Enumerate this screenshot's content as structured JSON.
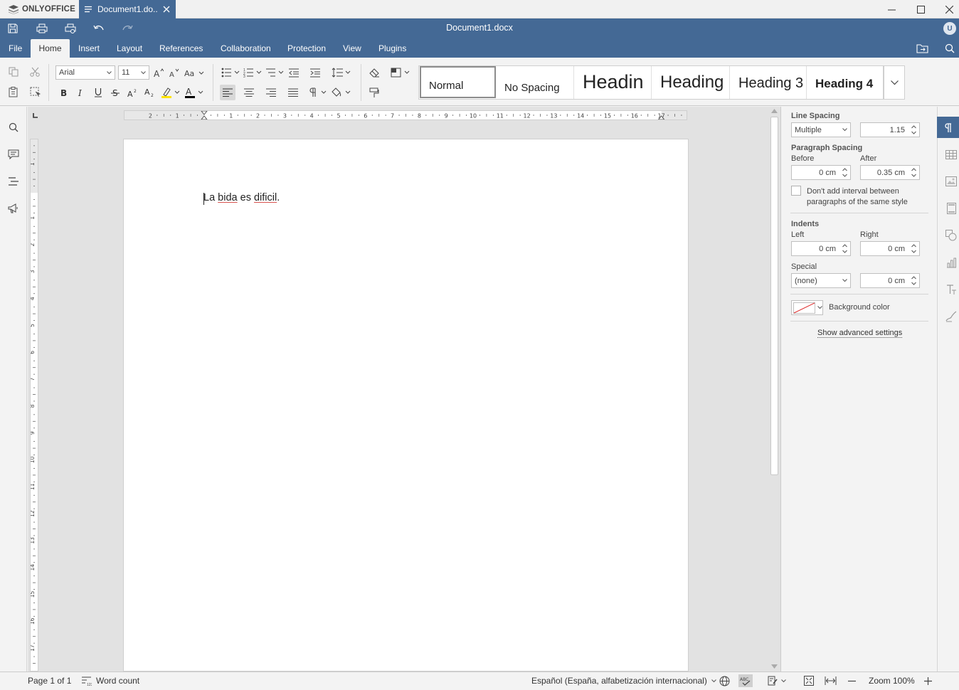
{
  "app": {
    "brand": "ONLYOFFICE"
  },
  "tab": {
    "label": "Document1.do..."
  },
  "header": {
    "title": "Document1.docx",
    "avatar": "U"
  },
  "menu": {
    "file": "File",
    "home": "Home",
    "insert": "Insert",
    "layout": "Layout",
    "references": "References",
    "collaboration": "Collaboration",
    "protection": "Protection",
    "view": "View",
    "plugins": "Plugins"
  },
  "toolbar": {
    "font_name": "Arial",
    "font_size": "11"
  },
  "styles": {
    "normal": "Normal",
    "no_spacing": "No Spacing",
    "heading1": "Headin",
    "heading2": "Heading",
    "heading3": "Heading 3",
    "heading4": "Heading 4"
  },
  "document": {
    "w1": "La",
    "w2": "bida",
    "w3": "es",
    "w4": "dificil",
    "w5": "."
  },
  "panel": {
    "line_spacing_label": "Line Spacing",
    "line_spacing_type": "Multiple",
    "line_spacing_value": "1.15",
    "paragraph_spacing_label": "Paragraph Spacing",
    "before_label": "Before",
    "before_value": "0 cm",
    "after_label": "After",
    "after_value": "0.35 cm",
    "no_interval_line1": "Don't add interval between",
    "no_interval_line2": "paragraphs of the same style",
    "indents_label": "Indents",
    "left_label": "Left",
    "left_value": "0 cm",
    "right_label": "Right",
    "right_value": "0 cm",
    "special_label": "Special",
    "special_type": "(none)",
    "special_value": "0 cm",
    "background_color_label": "Background color",
    "advanced_link": "Show advanced settings"
  },
  "ruler": {
    "h_labels": [
      "2",
      "1",
      "1",
      "2",
      "3",
      "4",
      "5",
      "6",
      "7",
      "8",
      "9",
      "10",
      "11",
      "12",
      "13",
      "14",
      "15",
      "16",
      "17"
    ],
    "v_labels": [
      "1",
      "1",
      "2",
      "3",
      "4",
      "5",
      "6",
      "7",
      "8",
      "9",
      "10",
      "11",
      "12",
      "13",
      "14",
      "15",
      "16",
      "17"
    ]
  },
  "status": {
    "page": "Page 1 of 1",
    "word_count": "Word count",
    "language": "Español (España, alfabetización internacional)",
    "zoom": "Zoom 100%"
  },
  "colors": {
    "header_blue": "#446995",
    "spell_underline": "#d9534f"
  },
  "icons": [
    "save-icon",
    "print-icon",
    "quick-print-icon",
    "undo-icon",
    "redo-icon",
    "open-location-icon",
    "search-icon",
    "copy-icon",
    "paste-icon",
    "cut-icon",
    "select-all-icon",
    "bold-icon",
    "italic-icon",
    "underline-icon",
    "strikethrough-icon",
    "superscript-icon",
    "subscript-icon",
    "highlight-icon",
    "font-color-icon",
    "paragraph-icon",
    "table-icon",
    "image-icon",
    "header-footer-icon",
    "shape-icon",
    "chart-icon",
    "text-art-icon",
    "signature-icon",
    "globe-icon",
    "spellcheck-icon",
    "track-changes-icon",
    "fit-page-icon",
    "fit-width-icon",
    "zoom-out-icon",
    "zoom-in-icon"
  ]
}
